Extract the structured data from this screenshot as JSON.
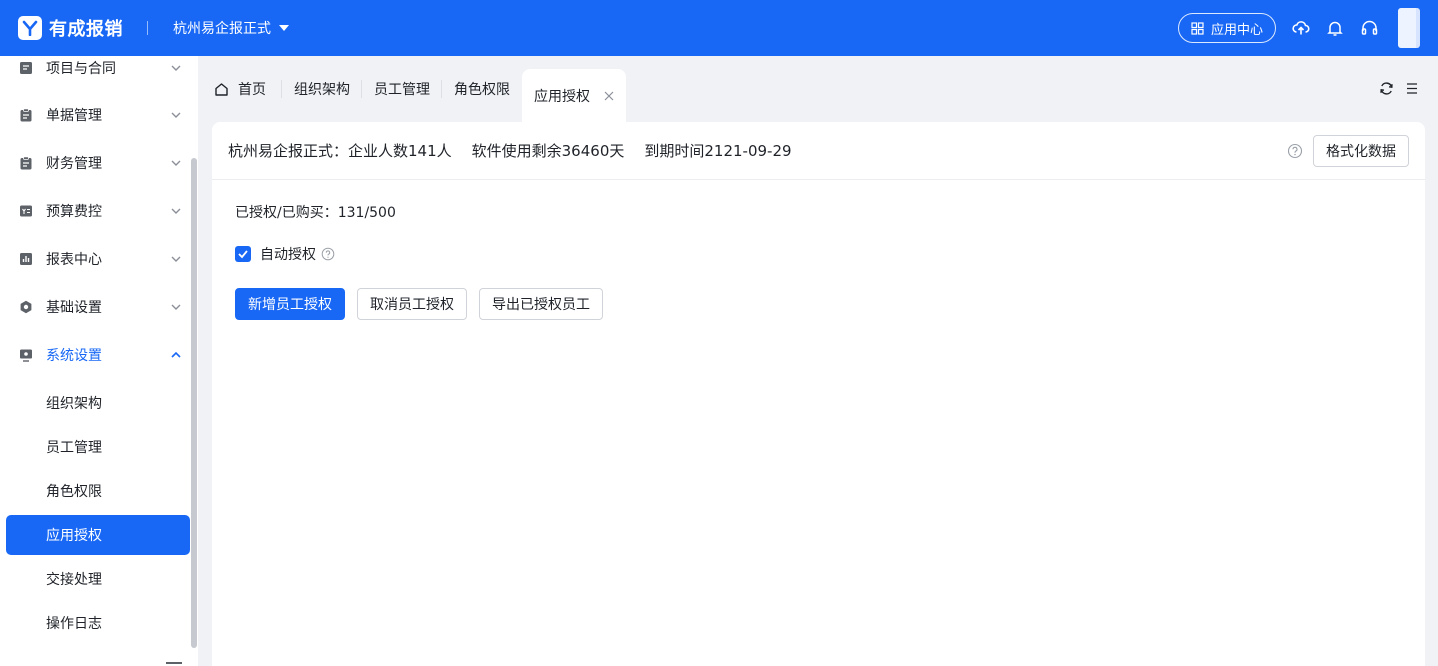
{
  "header": {
    "brand": "有成报销",
    "company": "杭州易企报正式",
    "app_center": "应用中心",
    "colors": {
      "primary": "#1868f5"
    }
  },
  "sidebar": {
    "menus": [
      {
        "label": "项目与合同",
        "icon": "contract-icon"
      },
      {
        "label": "单据管理",
        "icon": "clipboard-icon"
      },
      {
        "label": "财务管理",
        "icon": "clipboard-icon"
      },
      {
        "label": "预算费控",
        "icon": "budget-icon"
      },
      {
        "label": "报表中心",
        "icon": "chart-icon"
      },
      {
        "label": "基础设置",
        "icon": "gear-icon"
      },
      {
        "label": "系统设置",
        "icon": "monitor-icon"
      }
    ],
    "sub_items": [
      {
        "label": "组织架构"
      },
      {
        "label": "员工管理"
      },
      {
        "label": "角色权限"
      },
      {
        "label": "应用授权"
      },
      {
        "label": "交接处理"
      },
      {
        "label": "操作日志"
      }
    ]
  },
  "tabs": [
    {
      "label": "首页"
    },
    {
      "label": "组织架构"
    },
    {
      "label": "员工管理"
    },
    {
      "label": "角色权限"
    },
    {
      "label": "应用授权"
    }
  ],
  "card": {
    "company_info": "杭州易企报正式：企业人数141人",
    "remaining": "软件使用剩余36460天",
    "expire": "到期时间2121-09-29",
    "format_button": "格式化数据",
    "auth_count": "已授权/已购买：131/500",
    "auto_auth_label": "自动授权",
    "auto_auth_checked": true,
    "buttons": {
      "add": "新增员工授权",
      "cancel": "取消员工授权",
      "export": "导出已授权员工"
    }
  }
}
